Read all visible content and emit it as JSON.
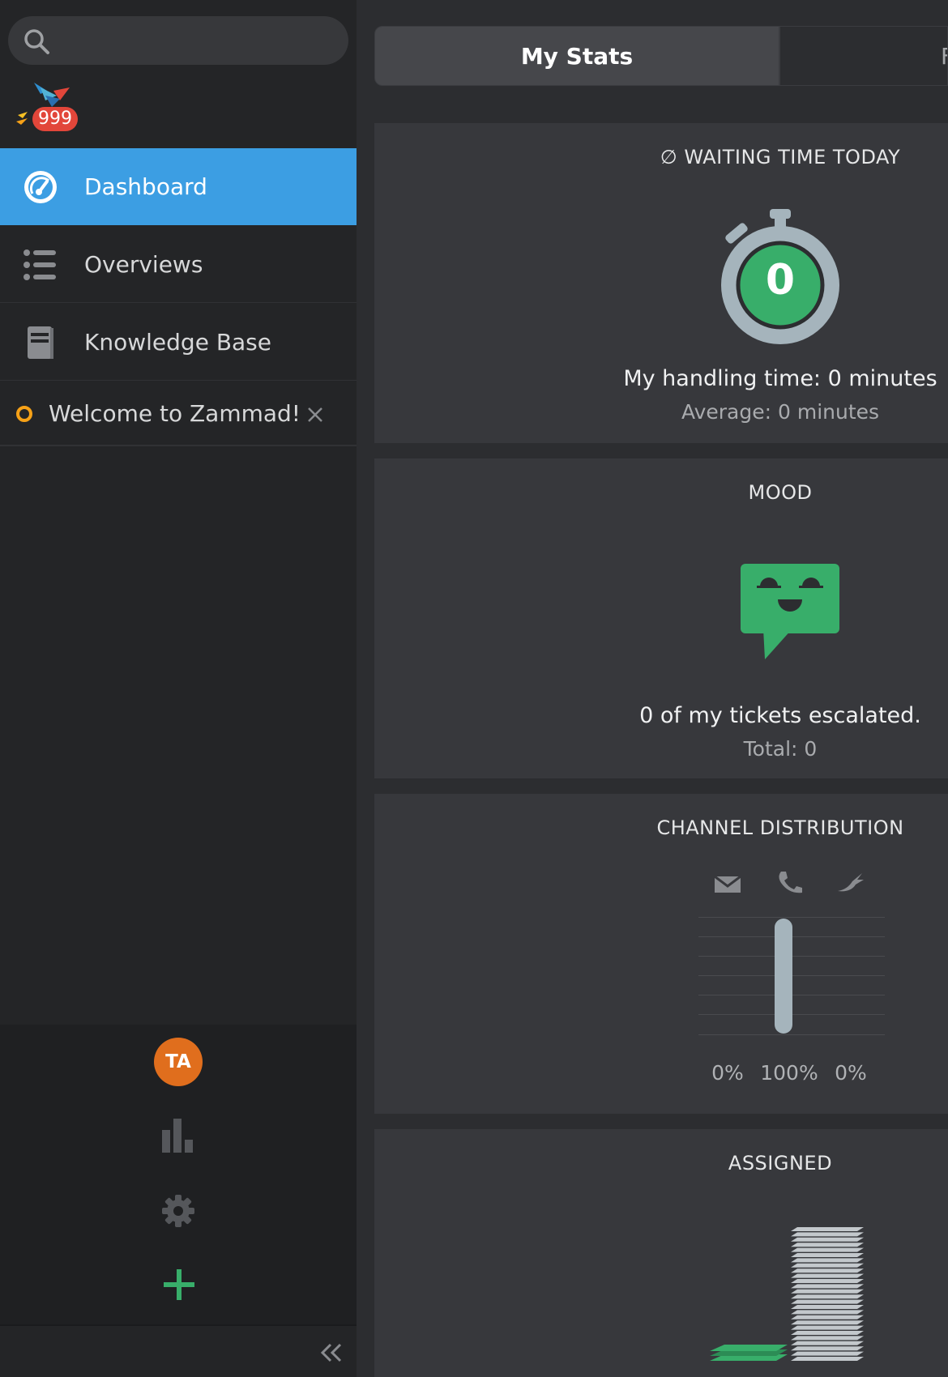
{
  "search": {
    "placeholder": ""
  },
  "notifications": {
    "badge": "999"
  },
  "nav": {
    "dashboard": "Dashboard",
    "overviews": "Overviews",
    "knowledge_base": "Knowledge Base"
  },
  "tasks": [
    {
      "title": "Welcome to Zammad!"
    }
  ],
  "user": {
    "initials": "TA"
  },
  "tabs": {
    "my_stats": "My Stats",
    "second_partial": "F"
  },
  "widgets": {
    "waiting": {
      "title": "∅ WAITING TIME TODAY",
      "value": "0",
      "main_line": "My handling time: 0 minutes",
      "sub_line": "Average: 0 minutes"
    },
    "mood": {
      "title": "MOOD",
      "main_line": "0 of my tickets escalated.",
      "sub_line": "Total: 0"
    },
    "channel": {
      "title": "CHANNEL DISTRIBUTION",
      "channels": [
        {
          "icon": "email-icon",
          "percent": "0%",
          "value": 0
        },
        {
          "icon": "phone-icon",
          "percent": "100%",
          "value": 100
        },
        {
          "icon": "twitter-bird-icon",
          "percent": "0%",
          "value": 0
        }
      ]
    },
    "assigned": {
      "title": "ASSIGNED"
    }
  },
  "colors": {
    "accent_blue": "#3c9ee3",
    "success_green": "#38ae6a",
    "avatar_orange": "#e06e1d",
    "badge_red": "#e2463a",
    "task_dot_orange": "#f6a117"
  }
}
